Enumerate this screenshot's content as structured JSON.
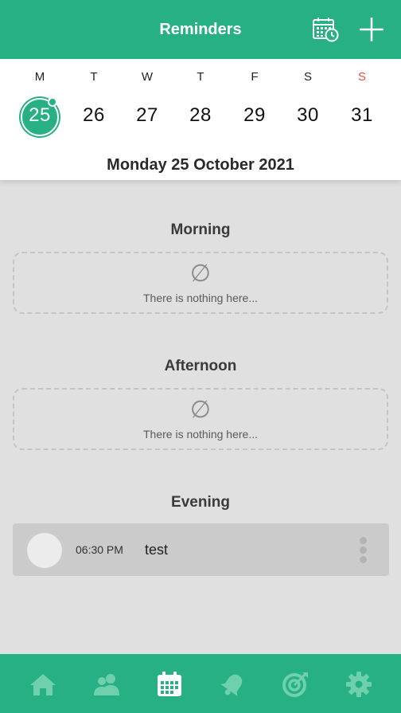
{
  "header": {
    "title": "Reminders",
    "calendar_button_icon": "calendar-clock-icon",
    "add_button_icon": "plus-icon"
  },
  "week": {
    "days": [
      {
        "letter": "M",
        "number": "25",
        "selected": true
      },
      {
        "letter": "T",
        "number": "26"
      },
      {
        "letter": "W",
        "number": "27"
      },
      {
        "letter": "T",
        "number": "28"
      },
      {
        "letter": "F",
        "number": "29"
      },
      {
        "letter": "S",
        "number": "30"
      },
      {
        "letter": "S",
        "number": "31",
        "weekend_highlight": true
      }
    ],
    "full_date": "Monday 25 October 2021"
  },
  "sections": {
    "morning": {
      "title": "Morning",
      "empty_text": "There is nothing here...",
      "empty_icon": "empty-set-icon"
    },
    "afternoon": {
      "title": "Afternoon",
      "empty_text": "There is nothing here...",
      "empty_icon": "empty-set-icon"
    },
    "evening": {
      "title": "Evening",
      "reminders": [
        {
          "time": "06:30 PM",
          "name": "test"
        }
      ]
    }
  },
  "tabbar": {
    "tabs": [
      {
        "icon": "home-icon",
        "active": false
      },
      {
        "icon": "people-icon",
        "active": false
      },
      {
        "icon": "calendar-icon",
        "active": true
      },
      {
        "icon": "bell-icon",
        "active": false
      },
      {
        "icon": "target-icon",
        "active": false
      },
      {
        "icon": "gear-icon",
        "active": false
      }
    ]
  },
  "colors": {
    "accent": "#26b083",
    "background": "#e0e0e0",
    "sunday": "#e05140",
    "tab_inactive": "#6fd0ad",
    "tab_active": "#ffffff"
  }
}
